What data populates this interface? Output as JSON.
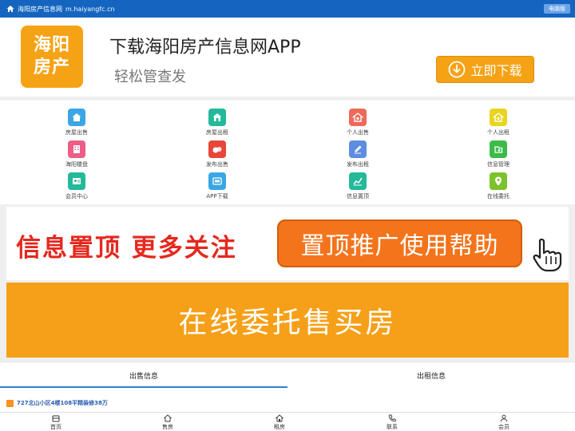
{
  "topbar": {
    "site_name": "海阳房产信息网",
    "site_url": "m.haiyangfc.cn",
    "pc_button": "电脑版"
  },
  "app_banner": {
    "logo_line1": "海阳",
    "logo_line2": "房产",
    "title": "下载海阳房产信息网APP",
    "subtitle": "轻松管查发",
    "download_button": "立即下载"
  },
  "grid": {
    "items": [
      {
        "label": "房屋出售",
        "icon": "house-sell-icon",
        "color": "#3aa6e6"
      },
      {
        "label": "房屋出租",
        "icon": "house-rent-icon",
        "color": "#23b99a"
      },
      {
        "label": "个人出售",
        "icon": "personal-sell-icon",
        "color": "#ee6a5a"
      },
      {
        "label": "个人出租",
        "icon": "personal-rent-icon",
        "color": "#e9d41e"
      },
      {
        "label": "海阳楼盘",
        "icon": "building-icon",
        "color": "#ef5c86"
      },
      {
        "label": "发布出售",
        "icon": "publish-sell-icon",
        "color": "#e8463a"
      },
      {
        "label": "发布出租",
        "icon": "publish-rent-icon",
        "color": "#5d8de0"
      },
      {
        "label": "信息管理",
        "icon": "info-manage-icon",
        "color": "#3dbb4a"
      },
      {
        "label": "会员中心",
        "icon": "member-icon",
        "color": "#23b99a"
      },
      {
        "label": "APP下载",
        "icon": "app-download-icon",
        "color": "#3aa6e6"
      },
      {
        "label": "信息置顶",
        "icon": "chart-top-icon",
        "color": "#23b99a"
      },
      {
        "label": "在线委托",
        "icon": "location-icon",
        "color": "#7cc22a"
      }
    ]
  },
  "promo1": {
    "left_text": "信息置顶 更多关注",
    "button_text": "置顶推广使用帮助"
  },
  "promo2": {
    "text": "在线委托售买房"
  },
  "tabs": [
    {
      "label": "出售信息",
      "active": true
    },
    {
      "label": "出租信息",
      "active": false
    }
  ],
  "listing": {
    "title": "727北山小区4楼108平精装修38万"
  },
  "bottom_nav": [
    {
      "label": "首页",
      "icon": "home-icon"
    },
    {
      "label": "售房",
      "icon": "sell-house-icon"
    },
    {
      "label": "租房",
      "icon": "rent-house-icon"
    },
    {
      "label": "联系",
      "icon": "phone-icon"
    },
    {
      "label": "会员",
      "icon": "user-icon"
    }
  ]
}
